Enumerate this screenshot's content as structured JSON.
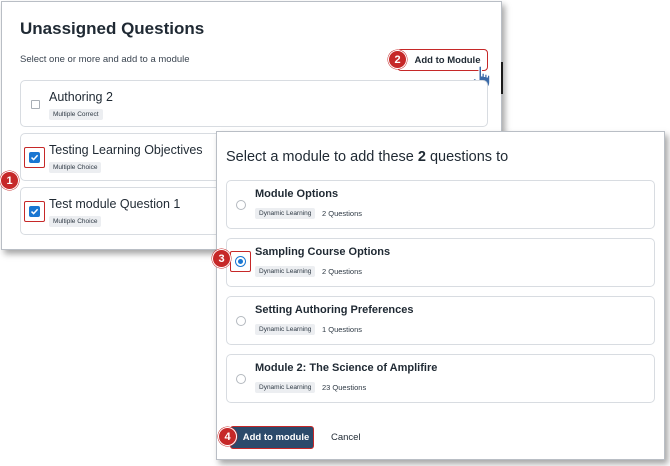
{
  "left_panel": {
    "title": "Unassigned Questions",
    "subtitle": "Select one or more and add to a module",
    "add_button_label": "Add to Module",
    "questions": [
      {
        "title": "Authoring 2",
        "tag": "Multiple Correct",
        "checked": false
      },
      {
        "title": "Testing Learning Objectives",
        "tag": "Multiple Choice",
        "checked": true
      },
      {
        "title": "Test module Question 1",
        "tag": "Multiple Choice",
        "checked": true
      }
    ]
  },
  "right_panel": {
    "title_prefix": "Select a module to add these",
    "title_count": "2",
    "title_suffix": "questions to",
    "modules": [
      {
        "name": "Module Options",
        "tag": "Dynamic Learning",
        "count": "2 Questions",
        "selected": false
      },
      {
        "name": "Sampling Course Options",
        "tag": "Dynamic Learning",
        "count": "2 Questions",
        "selected": true
      },
      {
        "name": "Setting Authoring Preferences",
        "tag": "Dynamic Learning",
        "count": "1 Questions",
        "selected": false
      },
      {
        "name": "Module 2: The Science of Amplifire",
        "tag": "Dynamic Learning",
        "count": "23 Questions",
        "selected": false
      }
    ],
    "add_button_label": "Add to module",
    "cancel_label": "Cancel"
  },
  "step_badges": [
    "1",
    "2",
    "3",
    "4"
  ],
  "colors": {
    "highlight": "#c62828",
    "checkbox_blue": "#1976d2",
    "primary_button": "#2b4a6b"
  },
  "icons": {
    "cursor": "hand-pointer-icon",
    "check": "checkmark-icon"
  }
}
